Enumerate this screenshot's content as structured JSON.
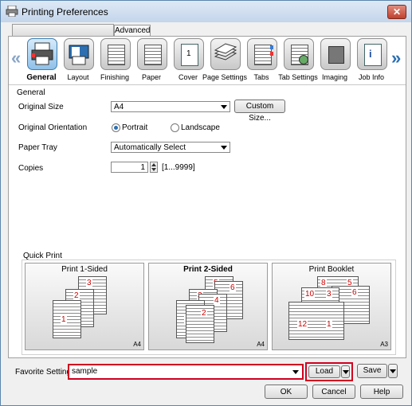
{
  "window": {
    "title": "Printing Preferences",
    "close_label": "✕"
  },
  "tabs": {
    "hidden_tab": "",
    "advanced": "Advanced"
  },
  "ribbon": {
    "items": [
      {
        "label": "General",
        "icon": "general-icon",
        "selected": true
      },
      {
        "label": "Layout",
        "icon": "layout-icon"
      },
      {
        "label": "Finishing",
        "icon": "finishing-icon"
      },
      {
        "label": "Paper",
        "icon": "paper-icon"
      },
      {
        "label": "Cover",
        "icon": "cover-icon"
      },
      {
        "label": "Page Settings",
        "icon": "page-settings-icon"
      },
      {
        "label": "Tabs",
        "icon": "tabs-icon"
      },
      {
        "label": "Tab Settings",
        "icon": "tab-settings-icon"
      },
      {
        "label": "Imaging",
        "icon": "imaging-icon"
      },
      {
        "label": "Job Info",
        "icon": "job-info-icon"
      }
    ]
  },
  "general": {
    "group_title": "General",
    "original_size_label": "Original Size",
    "original_size_value": "A4",
    "custom_size_button": "Custom Size...",
    "orientation_label": "Original Orientation",
    "portrait": "Portrait",
    "landscape": "Landscape",
    "orientation_selected": "Portrait",
    "paper_tray_label": "Paper Tray",
    "paper_tray_value": "Automatically Select",
    "copies_label": "Copies",
    "copies_value": "1",
    "copies_range": "[1...9999]"
  },
  "quick_print": {
    "title": "Quick Print",
    "options": [
      {
        "label": "Print 1-Sided",
        "size": "A4",
        "pages": [
          "3",
          "2",
          "1"
        ]
      },
      {
        "label": "Print 2-Sided",
        "size": "A4",
        "pages": [
          "5",
          "6",
          "3",
          "4",
          "1",
          "2"
        ]
      },
      {
        "label": "Print Booklet",
        "size": "A3",
        "pages": [
          "8",
          "5",
          "6",
          "10",
          "3",
          "12",
          "1"
        ]
      }
    ]
  },
  "favorite": {
    "label": "Favorite Setting",
    "value": "sample",
    "load": "Load",
    "save": "Save"
  },
  "footer": {
    "ok": "OK",
    "cancel": "Cancel",
    "help": "Help"
  },
  "colors": {
    "accent_border": "#d00020",
    "selected_ribbon": "#8fc0e8"
  }
}
